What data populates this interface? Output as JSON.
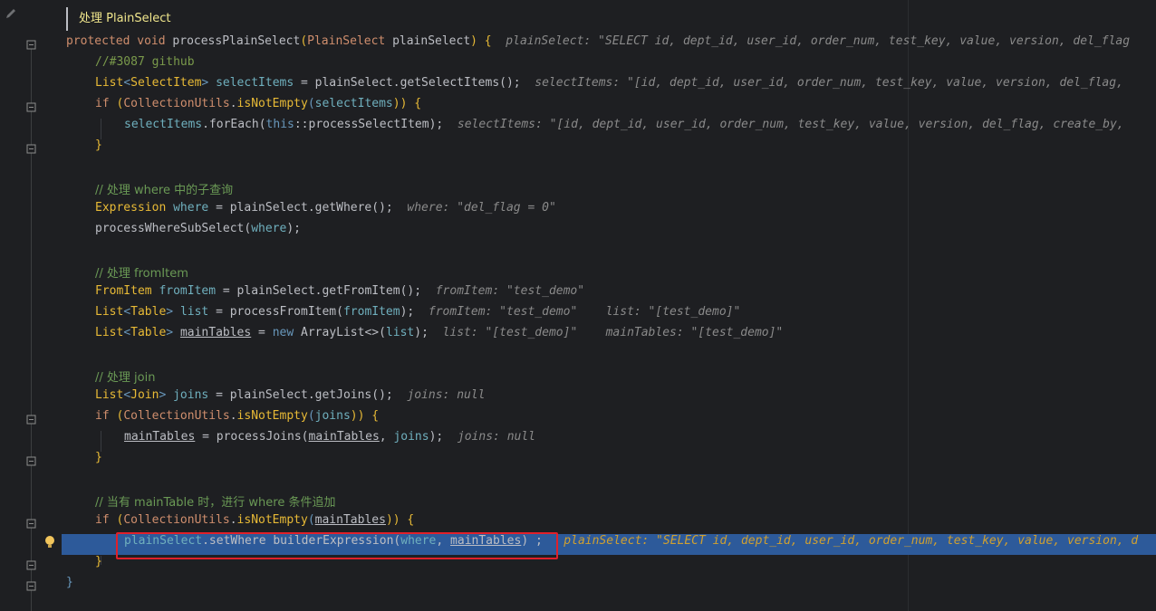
{
  "doc_comment": "处理 PlainSelect",
  "lines": {
    "l1": {
      "a": "protected",
      "b": "void",
      "c": "processPlainSelect",
      "d": "(",
      "e": "PlainSelect",
      "f": "plainSelect",
      "g": ") {",
      "hint": "plainSelect: \"SELECT id, dept_id, user_id, order_num, test_key, value, version, del_flag"
    },
    "l2": {
      "text": "//#3087 github"
    },
    "l3": {
      "a": "List",
      "b": "<",
      "c": "SelectItem",
      "d": ">",
      "e": "selectItems",
      "f": " = plainSelect.getSelectItems();",
      "hint": "selectItems: \"[id, dept_id, user_id, order_num, test_key, value, version, del_flag,"
    },
    "l4": {
      "a": "if",
      "b": " (",
      "c": "CollectionUtils",
      "d": ".",
      "e": "isNotEmpty",
      "f": "(",
      "g": "selectItems",
      "h": ")) {"
    },
    "l5": {
      "a": "selectItems",
      "b": ".forEach(",
      "c": "this",
      "d": "::processSelectItem);",
      "hint": "selectItems: \"[id, dept_id, user_id, order_num, test_key, value, version, del_flag, create_by,"
    },
    "l6": {
      "text": "}"
    },
    "l7": {
      "text": "// 处理 where 中的子查询"
    },
    "l8": {
      "a": "Expression",
      "b": "where",
      "c": " = plainSelect.getWhere();",
      "hint": "where: \"del_flag = 0\""
    },
    "l9": {
      "a": "processWhereSubSelect(",
      "b": "where",
      "c": ");"
    },
    "l10": {
      "text": "// 处理 fromItem"
    },
    "l11": {
      "a": "FromItem",
      "b": "fromItem",
      "c": " = plainSelect.getFromItem();",
      "hint": "fromItem: \"test_demo\""
    },
    "l12": {
      "a": "List",
      "b": "<",
      "c": "Table",
      "d": ">",
      "e": "list",
      "f": " = processFromItem(",
      "g": "fromItem",
      "h": ");",
      "hint1": "fromItem: \"test_demo\"",
      "hint2": "list: \"[test_demo]\""
    },
    "l13": {
      "a": "List",
      "b": "<",
      "c": "Table",
      "d": ">",
      "e": "mainTables",
      "f": " = ",
      "g": "new",
      "h": " ArrayList<>(",
      "i": "list",
      "j": ");",
      "hint1": "list: \"[test_demo]\"",
      "hint2": "mainTables: \"[test_demo]\""
    },
    "l14": {
      "text": "// 处理 join"
    },
    "l15": {
      "a": "List",
      "b": "<",
      "c": "Join",
      "d": ">",
      "e": "joins",
      "f": " = plainSelect.getJoins();",
      "hint": "joins: null"
    },
    "l16": {
      "a": "if",
      "b": " (",
      "c": "CollectionUtils",
      "d": ".",
      "e": "isNotEmpty",
      "f": "(",
      "g": "joins",
      "h": ")) {"
    },
    "l17": {
      "a": "mainTables",
      "b": " = processJoins(",
      "c": "mainTables",
      "d": ", ",
      "e": "joins",
      "f": ");",
      "hint": "joins: null"
    },
    "l18": {
      "text": "}"
    },
    "l19": {
      "text": "// 当有 mainTable 时，进行 where 条件追加"
    },
    "l20": {
      "a": "if",
      "b": " (",
      "c": "CollectionUtils",
      "d": ".",
      "e": "isNotEmpty",
      "f": "(",
      "g": "mainTables",
      "h": ")) {"
    },
    "l21": {
      "a": "plainSelect",
      "b": ".setWhere builderExpression(",
      "c": "where",
      "d": ", ",
      "e": "mainTables",
      "f": ") ;",
      "hint": "plainSelect: \"SELECT id, dept_id, user_id, order_num, test_key, value, version, d"
    },
    "l22": {
      "text": "}"
    },
    "l23": {
      "text": "}"
    }
  },
  "colors": {
    "background": "#1e1f22",
    "highlight": "#2d5a9a",
    "redbox": "#e0202a"
  }
}
